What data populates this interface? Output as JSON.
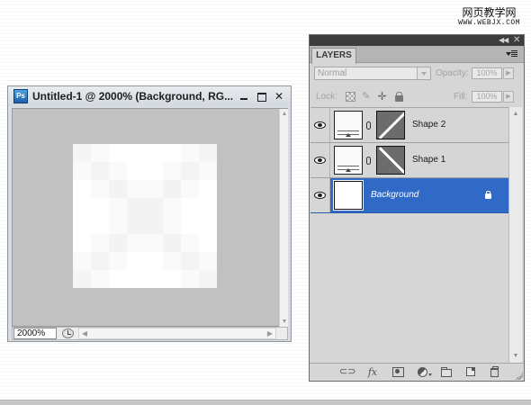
{
  "watermark": {
    "title": "网页教学网",
    "url": "WWW.WEBJX.COM"
  },
  "document": {
    "icon": "ps-icon",
    "title": "Untitled-1 @ 2000% (Background, RG...",
    "zoom": "2000%",
    "pixels": [
      "#f5f5f5",
      "#fafafa",
      "#ffffff",
      "#ffffff",
      "#ffffff",
      "#ffffff",
      "#fafafa",
      "#f5f5f5",
      "#fafafa",
      "#f4f4f4",
      "#fafafa",
      "#ffffff",
      "#ffffff",
      "#fafafa",
      "#f4f4f4",
      "#fafafa",
      "#ffffff",
      "#fafafa",
      "#f3f3f3",
      "#fafafa",
      "#fafafa",
      "#f3f3f3",
      "#fafafa",
      "#ffffff",
      "#ffffff",
      "#ffffff",
      "#fafafa",
      "#f3f3f3",
      "#f3f3f3",
      "#fafafa",
      "#ffffff",
      "#ffffff",
      "#ffffff",
      "#ffffff",
      "#fafafa",
      "#f3f3f3",
      "#f3f3f3",
      "#fafafa",
      "#ffffff",
      "#ffffff",
      "#ffffff",
      "#fafafa",
      "#f3f3f3",
      "#fafafa",
      "#fafafa",
      "#f3f3f3",
      "#fafafa",
      "#ffffff",
      "#fafafa",
      "#f4f4f4",
      "#fafafa",
      "#ffffff",
      "#ffffff",
      "#fafafa",
      "#f4f4f4",
      "#fafafa",
      "#f5f5f5",
      "#fafafa",
      "#ffffff",
      "#ffffff",
      "#ffffff",
      "#ffffff",
      "#fafafa",
      "#f5f5f5"
    ]
  },
  "layers_panel": {
    "tab": "LAYERS",
    "blend_mode": "Normal",
    "opacity_label": "Opacity:",
    "opacity_value": "100%",
    "lock_label": "Lock:",
    "fill_label": "Fill:",
    "fill_value": "100%",
    "selected_color": "#3169c6",
    "layers": [
      {
        "name": "Shape 2",
        "visible": true,
        "selected": false
      },
      {
        "name": "Shape 1",
        "visible": true,
        "selected": false
      },
      {
        "name": "Background",
        "visible": true,
        "selected": true,
        "locked": true
      }
    ],
    "footer_icons": [
      "link-layers-icon",
      "fx-icon",
      "add-mask-icon",
      "adjustment-layer-icon",
      "new-group-icon",
      "new-layer-icon",
      "delete-layer-icon"
    ]
  }
}
